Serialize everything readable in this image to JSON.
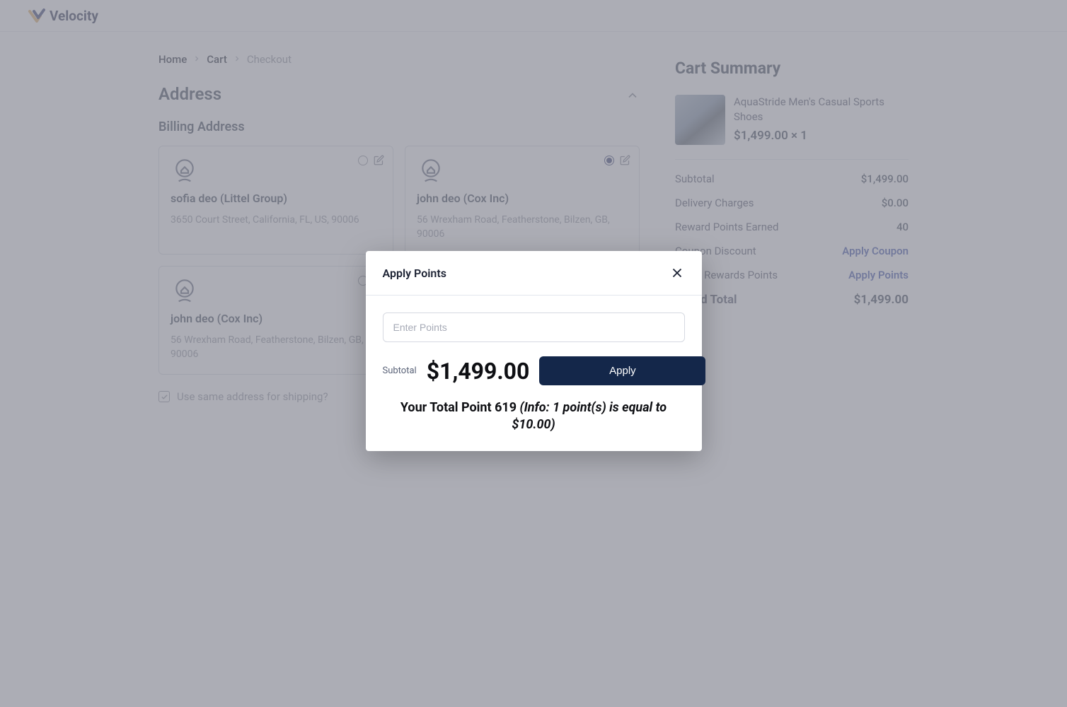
{
  "brand": "Velocity",
  "breadcrumb": {
    "home": "Home",
    "cart": "Cart",
    "checkout": "Checkout"
  },
  "address": {
    "heading": "Address",
    "billing_heading": "Billing Address",
    "same_shipping": "Use same address for shipping?",
    "cards": [
      {
        "name": "sofia deo (Littel Group)",
        "addr": "3650 Court Street, California, FL, US, 90006",
        "selected": false
      },
      {
        "name": "john deo (Cox Inc)",
        "addr": "56 Wrexham Road, Featherstone, Bilzen, GB, 90006",
        "selected": true
      },
      {
        "name": "john deo (Cox Inc)",
        "addr": "56 Wrexham Road, Featherstone, Bilzen, GB, 90006",
        "selected": false
      }
    ]
  },
  "cart": {
    "title": "Cart Summary",
    "item": {
      "name": "AquaStride Men's Casual Sports Shoes",
      "priceline": "$1,499.00 × 1"
    },
    "rows": {
      "subtotal_label": "Subtotal",
      "subtotal_value": "$1,499.00",
      "delivery_label": "Delivery Charges",
      "delivery_value": "$0.00",
      "reward_label": "Reward Points Earned",
      "reward_value": "40",
      "coupon_label": "Coupon Discount",
      "coupon_link": "Apply Coupon",
      "points_label": "Apply Rewards Points",
      "points_link": "Apply Points",
      "grand_label": "Grand Total",
      "grand_value": "$1,499.00"
    }
  },
  "modal": {
    "title": "Apply Points",
    "placeholder": "Enter Points",
    "subtotal_label": "Subtotal",
    "subtotal_value": "$1,499.00",
    "apply": "Apply",
    "info_prefix": "Your Total Point 619 ",
    "info_italic": "(Info: 1 point(s) is equal to $10.00)"
  }
}
